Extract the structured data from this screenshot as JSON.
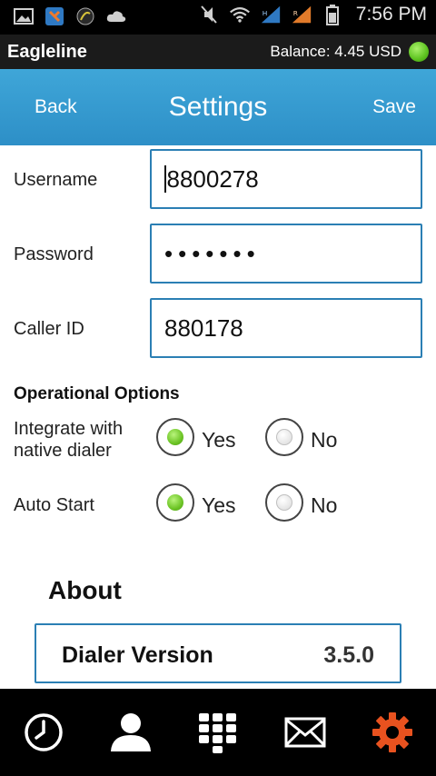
{
  "status_bar": {
    "time": "7:56 PM",
    "left_icons": [
      "gallery-icon",
      "app-icon",
      "signal-app-icon",
      "cloud-icon"
    ],
    "right_icons": [
      "mute-icon",
      "wifi-icon",
      "cell-signal-icon",
      "cell-signal-2-icon",
      "battery-icon"
    ]
  },
  "app_header": {
    "brand": "Eagleline",
    "balance": "Balance: 4.45 USD",
    "status_color": "#5cc21f"
  },
  "title_bar": {
    "back_label": "Back",
    "title": "Settings",
    "save_label": "Save",
    "color": "#3399cf"
  },
  "form": {
    "username": {
      "label": "Username",
      "value": "8800278"
    },
    "password": {
      "label": "Password",
      "value": "•••••••"
    },
    "caller_id": {
      "label": "Caller ID",
      "value": "880178"
    }
  },
  "operational_options": {
    "title": "Operational Options",
    "integrate": {
      "label": "Integrate with native dialer",
      "yes": "Yes",
      "no": "No",
      "selected": "Yes"
    },
    "auto_start": {
      "label": "Auto Start",
      "yes": "Yes",
      "no": "No",
      "selected": "Yes"
    }
  },
  "about": {
    "title": "About",
    "dialer_version_label": "Dialer Version",
    "dialer_version_value": "3.5.0"
  },
  "bottom_nav": {
    "items": [
      "history-icon",
      "contacts-icon",
      "dialpad-icon",
      "messages-icon",
      "settings-icon"
    ],
    "active": "settings-icon",
    "active_color": "#e8521f"
  }
}
